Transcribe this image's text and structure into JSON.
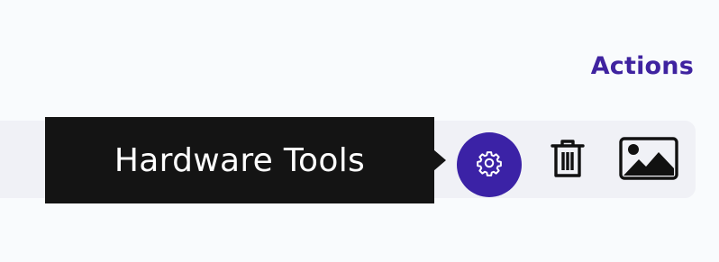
{
  "header": {
    "actions_label": "Actions"
  },
  "tooltip": {
    "text": "Hardware Tools"
  },
  "actions": [
    {
      "icon": "gear-icon",
      "active": true
    },
    {
      "icon": "trash-icon",
      "active": false
    },
    {
      "icon": "image-icon",
      "active": false
    }
  ],
  "colors": {
    "accent": "#3b22a6",
    "header_text": "#3f23a0",
    "tooltip_bg": "#141414",
    "row_bg": "#f0f1f6"
  }
}
